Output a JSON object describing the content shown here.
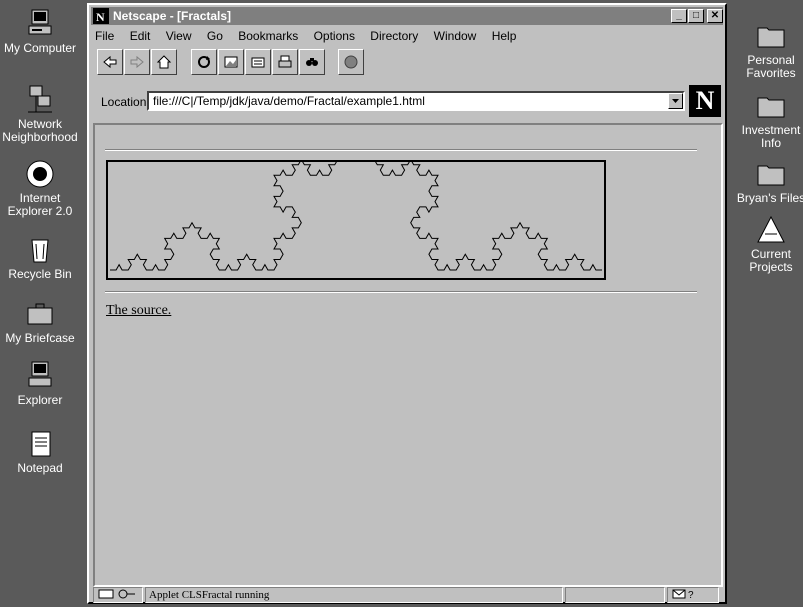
{
  "desktop_left": [
    {
      "label": "My Computer",
      "icon": "my-computer-icon"
    },
    {
      "label": "Network Neighborhood",
      "icon": "network-neighborhood-icon"
    },
    {
      "label": "Internet Explorer 2.0",
      "icon": "internet-explorer-icon"
    },
    {
      "label": "Recycle Bin",
      "icon": "recycle-bin-icon"
    },
    {
      "label": "My Briefcase",
      "icon": "briefcase-icon"
    },
    {
      "label": "Explorer",
      "icon": "explorer-icon"
    },
    {
      "label": "Notepad",
      "icon": "notepad-icon"
    }
  ],
  "desktop_right": [
    {
      "label": "Personal Favorites",
      "icon": "folder-icon"
    },
    {
      "label": "Investment Info",
      "icon": "folder-icon"
    },
    {
      "label": "Bryan's Files",
      "icon": "folder-icon"
    },
    {
      "label": "Current Projects",
      "icon": "projects-shortcut-icon"
    }
  ],
  "window": {
    "title": "Netscape - [Fractals]",
    "controls": {
      "minimize": "_",
      "maximize": "□",
      "close": "✕"
    }
  },
  "menu": [
    "File",
    "Edit",
    "View",
    "Go",
    "Bookmarks",
    "Options",
    "Directory",
    "Window",
    "Help"
  ],
  "toolbar": [
    "back-icon",
    "forward-icon",
    "home-icon",
    "reload-icon",
    "images-icon",
    "open-icon",
    "print-icon",
    "find-icon",
    "stop-icon"
  ],
  "location": {
    "label": "Location:",
    "url": "file:///C|/Temp/jdk/java/demo/Fractal/example1.html"
  },
  "logo": {
    "letter": "N"
  },
  "page": {
    "link_text": "The source."
  },
  "status": {
    "message": "Applet CLSFractal running"
  },
  "colors": {
    "desktop": "#5a5a5a",
    "window": "#c0c0c0",
    "titlebar": "#7f7f7f"
  }
}
